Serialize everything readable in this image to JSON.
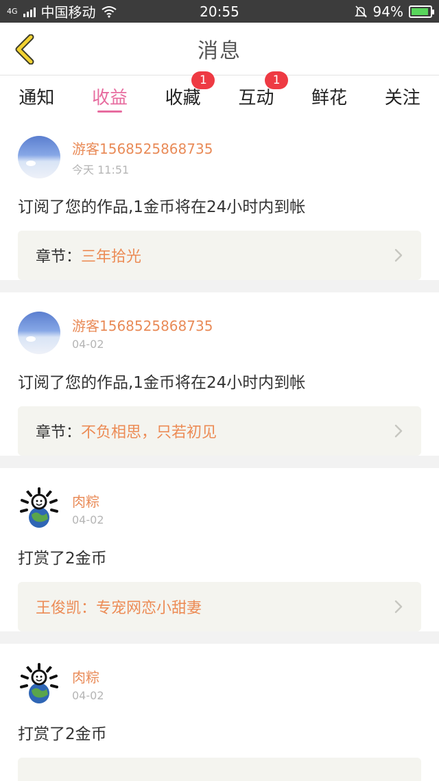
{
  "status_bar": {
    "network": "4G",
    "carrier": "中国移动",
    "time": "20:55",
    "battery": "94%",
    "battery_level": 0.94
  },
  "header": {
    "title": "消息"
  },
  "tabs": [
    {
      "label": "通知",
      "badge": ""
    },
    {
      "label": "收益",
      "badge": "",
      "active": true
    },
    {
      "label": "收藏",
      "badge": "1"
    },
    {
      "label": "互动",
      "badge": "1"
    },
    {
      "label": "鲜花",
      "badge": ""
    },
    {
      "label": "关注",
      "badge": ""
    }
  ],
  "messages": [
    {
      "user": "游客1568525868735",
      "time": "今天 11:51",
      "text": "订阅了您的作品,1金币将在24小时内到帐",
      "ref_label": "章节：",
      "ref_title": "三年拾光"
    },
    {
      "user": "游客1568525868735",
      "time": "04-02",
      "text": "订阅了您的作品,1金币将在24小时内到帐",
      "ref_label": "章节：",
      "ref_title": "不负相思，只若初见"
    },
    {
      "user": "肉粽",
      "time": "04-02",
      "text": "打赏了2金币",
      "ref_text": "王俊凯：专宠网恋小甜妻"
    },
    {
      "user": "肉粽",
      "time": "04-02",
      "text": "打赏了2金币"
    }
  ],
  "colors": {
    "accent": "#e76c9f",
    "username": "#e98b58",
    "badge": "#ee3a43",
    "status_bar": "#3c3c3c"
  }
}
